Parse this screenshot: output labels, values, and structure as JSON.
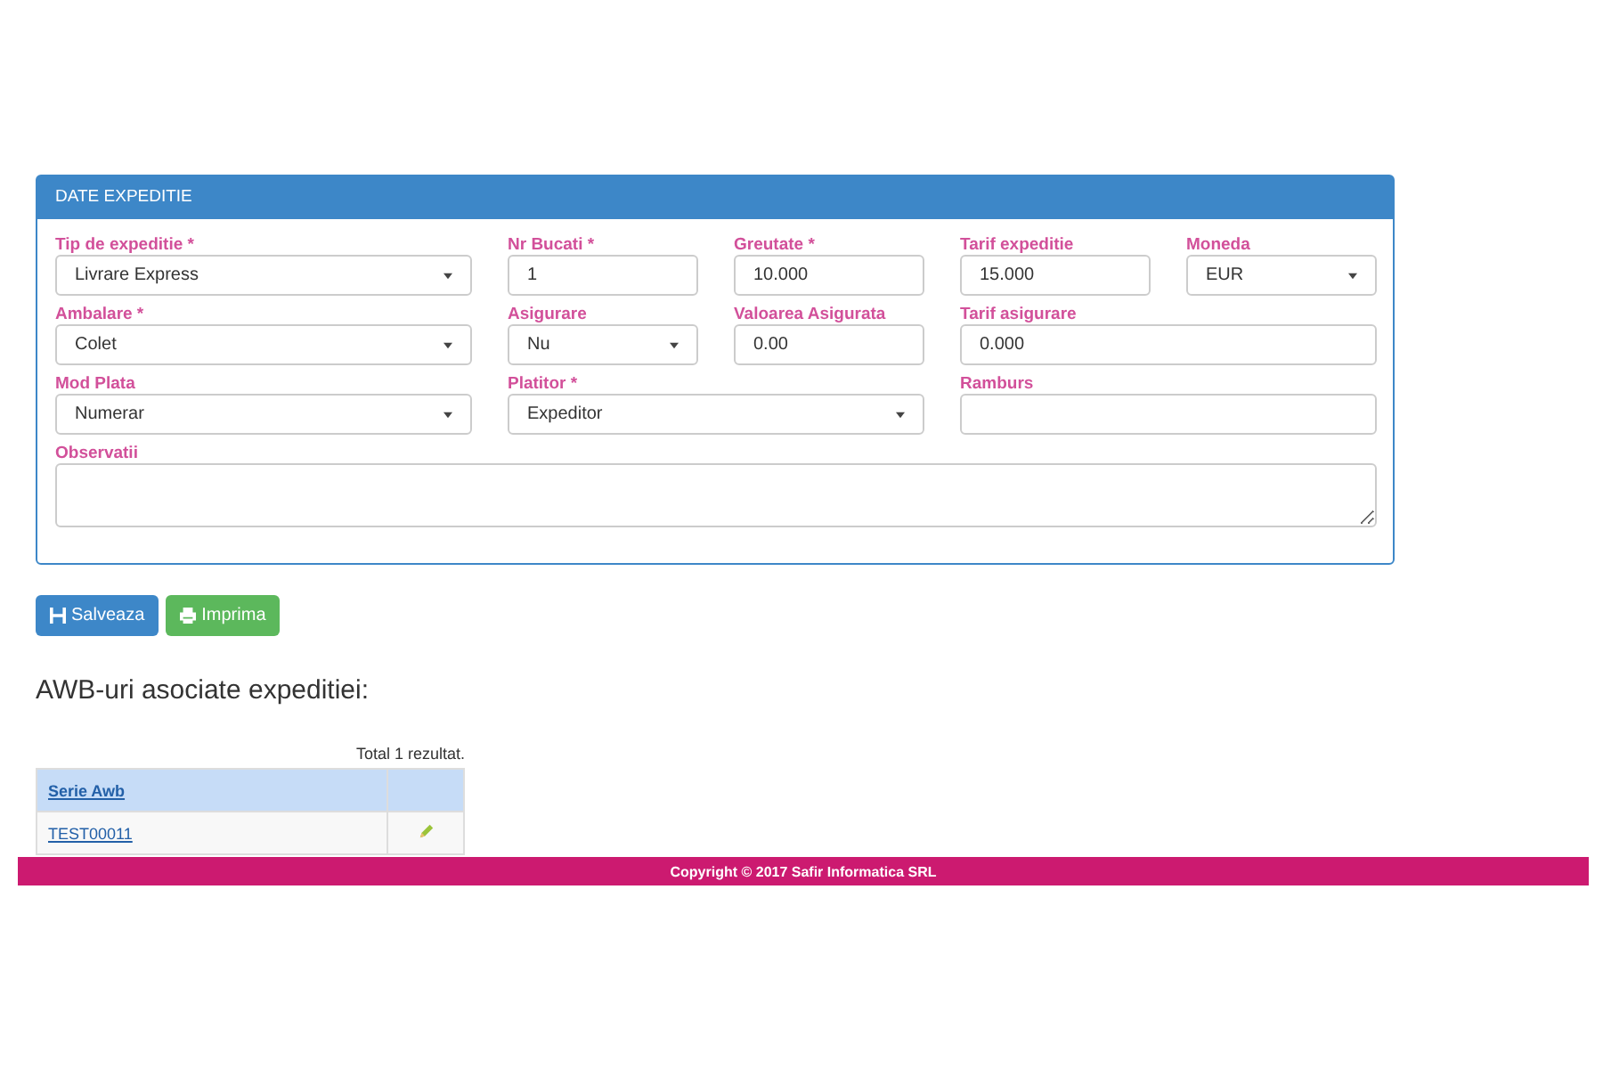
{
  "panel": {
    "title": "DATE EXPEDITIE",
    "fields": [
      {
        "label": "Tip de expeditie *",
        "kind": "select",
        "value": "Livrare Express"
      },
      {
        "label": "Nr Bucati *",
        "kind": "input",
        "value": "1"
      },
      {
        "label": "Greutate *",
        "kind": "input",
        "value": "10.000"
      },
      {
        "label": "Tarif expeditie",
        "kind": "input",
        "value": "15.000"
      },
      {
        "label": "Moneda",
        "kind": "select",
        "value": "EUR"
      },
      {
        "label": "Ambalare *",
        "kind": "select",
        "value": "Colet"
      },
      {
        "label": "Asigurare",
        "kind": "select",
        "value": "Nu"
      },
      {
        "label": "Valoarea Asigurata",
        "kind": "input",
        "value": "0.00"
      },
      {
        "label": "Tarif asigurare",
        "kind": "input",
        "value": "0.000"
      },
      {
        "label": "Mod Plata",
        "kind": "select",
        "value": "Numerar"
      },
      {
        "label": "Platitor *",
        "kind": "select",
        "value": "Expeditor"
      },
      {
        "label": "Ramburs",
        "kind": "input"
      },
      {
        "label": "Observatii",
        "kind": "textarea"
      }
    ]
  },
  "buttons": [
    {
      "label": "Salveaza",
      "kind": "save"
    },
    {
      "label": "Imprima",
      "kind": "print"
    }
  ],
  "section_title": "AWB-uri asociate expeditiei:",
  "table": {
    "summary": "Total 1 rezultat.",
    "columns": [
      "Serie Awb"
    ],
    "rows": [
      {
        "serie": "TEST00011"
      }
    ]
  },
  "footer": "Copyright © 2017 Safir Informatica SRL"
}
